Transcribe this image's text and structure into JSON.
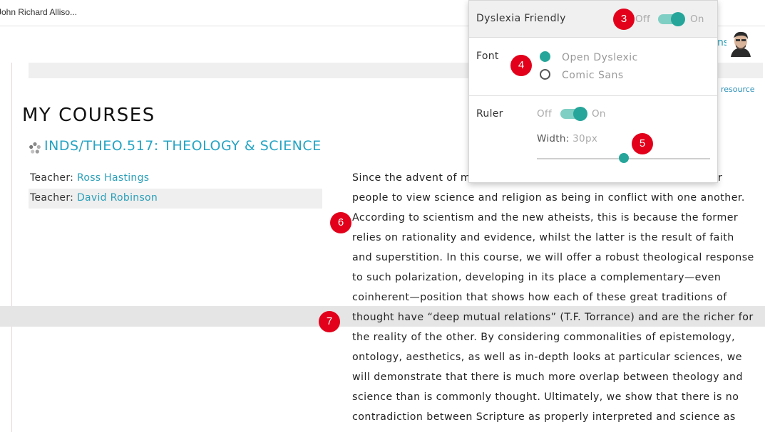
{
  "browser": {
    "tab_title": "John Richard Alliso..."
  },
  "header": {
    "partial_link": "ns",
    "resource_link": "resource"
  },
  "page": {
    "heading": "MY COURSES"
  },
  "course": {
    "code_title": "INDS/THEO.517: THEOLOGY & SCIENCE",
    "teachers": [
      {
        "label": "Teacher:",
        "name": "Ross Hastings"
      },
      {
        "label": "Teacher:",
        "name": "David Robinson"
      }
    ],
    "description_lines": [
      "Since the advent of m",
      "people to view science and religion as being in conflict with one another.",
      "According to scientism and the new atheists, this is because the former",
      "relies on rationality and evidence, whilst the latter is the result of faith",
      "and superstition. In this course, we will offer a robust theological response",
      "to such polarization, developing in its place a complementary—even",
      "coinherent—position that shows how each of these great traditions of",
      "thought have “deep mutual relations” (T.F. Torrance) and are the richer for",
      "the reality of the other. By considering commonalities of epistemology,",
      "ontology, aesthetics, as well as in-depth looks at particular sciences, we",
      "will demonstrate that there is much more overlap between theology and",
      "science than is commonly thought. Ultimately, we show that there is no",
      "contradiction between Scripture as properly interpreted and science as"
    ],
    "description_tail_fragment": "r"
  },
  "dyslexia_panel": {
    "title": "Dyslexia Friendly",
    "toggle_off": "Off",
    "toggle_on": "On",
    "toggle_state": true,
    "font_label": "Font",
    "font_options": [
      "Open Dyslexic",
      "Comic Sans"
    ],
    "font_selected": "Open Dyslexic",
    "ruler_label": "Ruler",
    "ruler_off": "Off",
    "ruler_on": "On",
    "ruler_state": true,
    "width_label": "Width:",
    "width_value": "30px",
    "width_fraction": 0.5
  },
  "callouts": [
    "3",
    "4",
    "5",
    "6",
    "7"
  ],
  "colors": {
    "accent": "#26a69a",
    "link": "#25a4c4",
    "callout": "#e2001a",
    "ruler_band": "#e5e5e5"
  },
  "icons": [
    "course-spinner-icon",
    "avatar"
  ]
}
